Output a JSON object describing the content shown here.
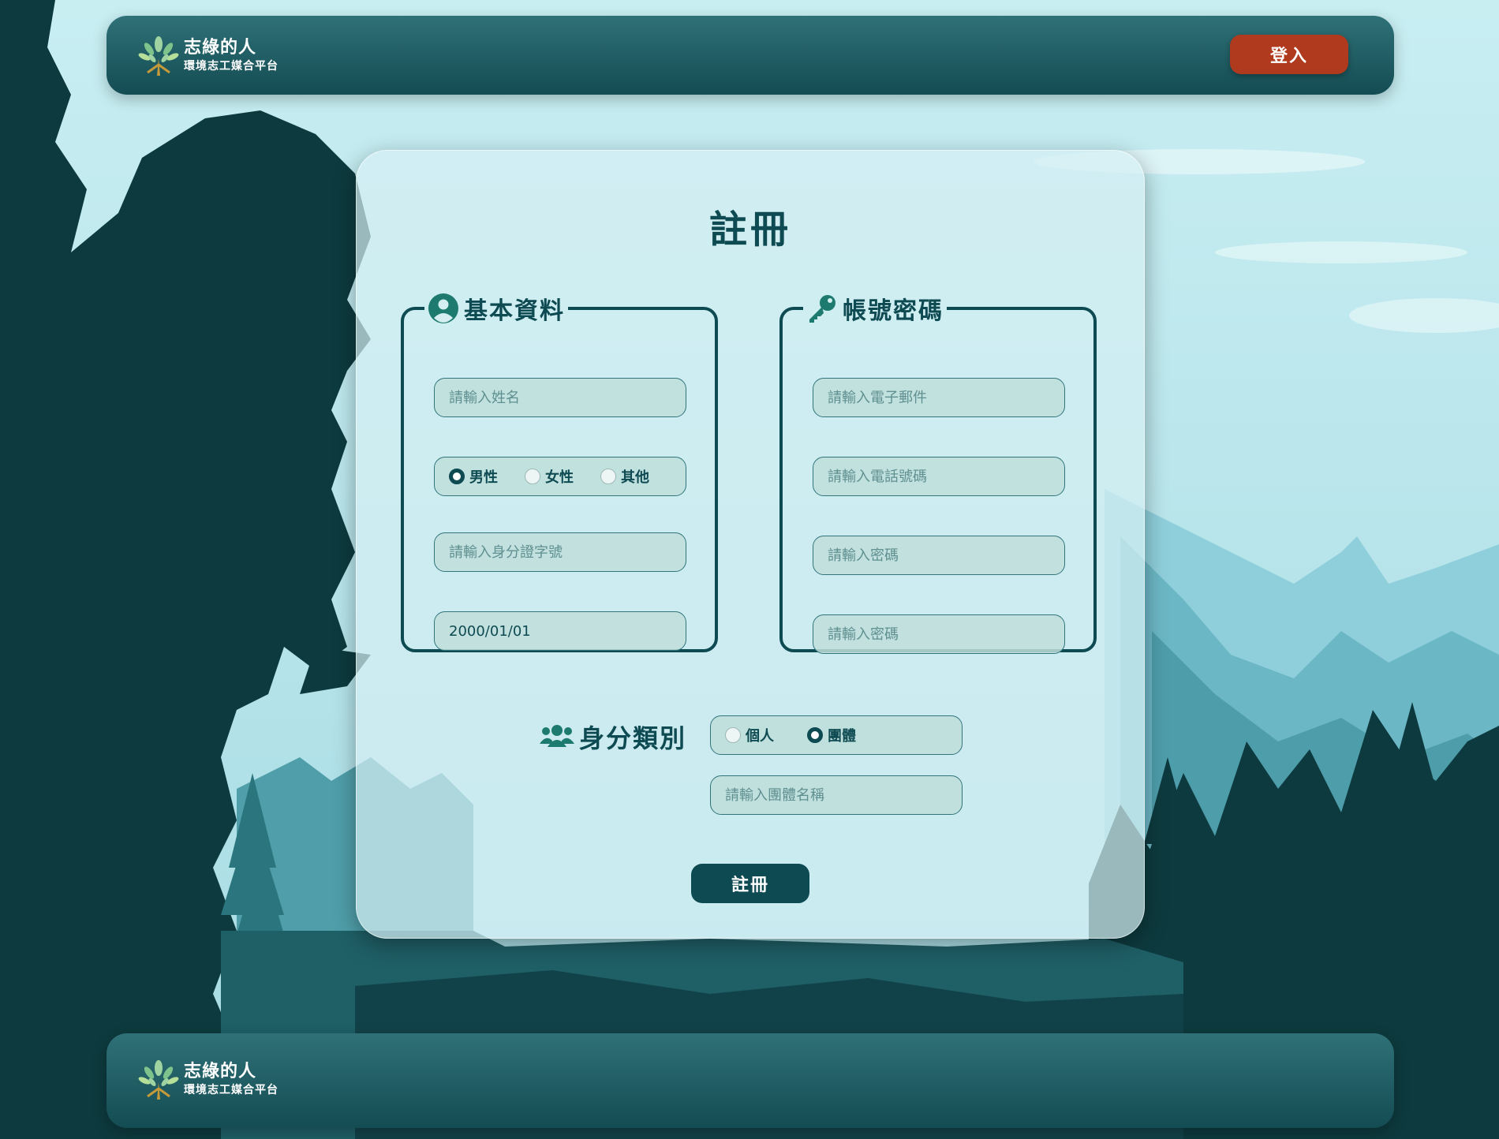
{
  "header": {
    "brand_name": "志綠的人",
    "brand_sub": "環境志工媒合平台",
    "login_label": "登入"
  },
  "form": {
    "title": "註冊",
    "basic": {
      "legend": "基本資料",
      "name_placeholder": "請輸入姓名",
      "gender_options": [
        "男性",
        "女性",
        "其他"
      ],
      "gender_selected": "男性",
      "id_placeholder": "請輸入身分證字號",
      "birthday_value": "2000/01/01"
    },
    "account": {
      "legend": "帳號密碼",
      "email_placeholder": "請輸入電子郵件",
      "phone_placeholder": "請輸入電話號碼",
      "password_placeholder": "請輸入密碼",
      "password_confirm_placeholder": "請輸入密碼"
    },
    "identity": {
      "label": "身分類別",
      "options": [
        "個人",
        "團體"
      ],
      "selected": "團體",
      "group_name_placeholder": "請輸入團體名稱"
    },
    "submit_label": "註冊"
  },
  "footer": {
    "brand_name": "志綠的人",
    "brand_sub": "環境志工媒合平台"
  },
  "colors": {
    "primary": "#0e4a52",
    "accent_login": "#b03a1e",
    "sky": "#c4e9ee"
  }
}
